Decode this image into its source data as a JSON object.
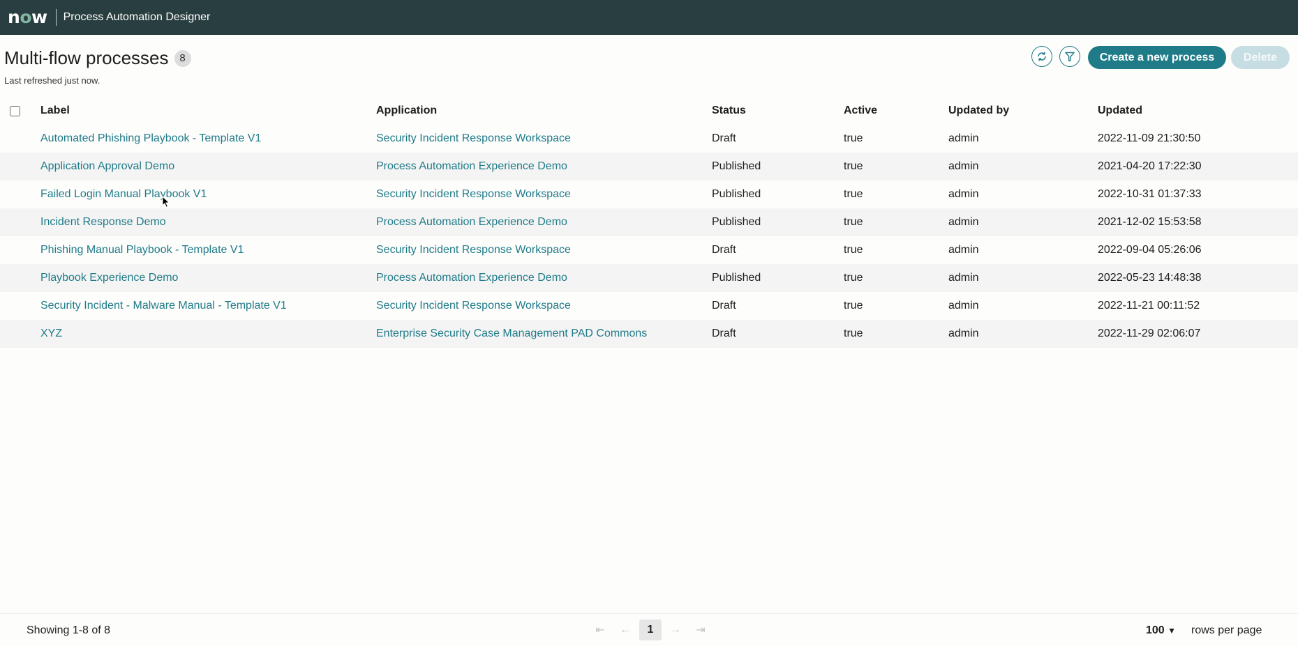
{
  "header": {
    "logo": "now",
    "app_title": "Process Automation Designer"
  },
  "page": {
    "title": "Multi-flow processes",
    "count": "8",
    "refreshed": "Last refreshed just now.",
    "refresh_icon": "refresh-icon",
    "filter_icon": "filter-icon",
    "create_label": "Create a new process",
    "delete_label": "Delete"
  },
  "table": {
    "columns": [
      "Label",
      "Application",
      "Status",
      "Active",
      "Updated by",
      "Updated"
    ],
    "rows": [
      {
        "label": "Automated Phishing Playbook - Template V1",
        "application": "Security Incident Response Workspace",
        "status": "Draft",
        "active": "true",
        "updated_by": "admin",
        "updated": "2022-11-09 21:30:50"
      },
      {
        "label": "Application Approval Demo",
        "application": "Process Automation Experience Demo",
        "status": "Published",
        "active": "true",
        "updated_by": "admin",
        "updated": "2021-04-20 17:22:30"
      },
      {
        "label": "Failed Login Manual Playbook V1",
        "application": "Security Incident Response Workspace",
        "status": "Published",
        "active": "true",
        "updated_by": "admin",
        "updated": "2022-10-31 01:37:33"
      },
      {
        "label": "Incident Response Demo",
        "application": "Process Automation Experience Demo",
        "status": "Published",
        "active": "true",
        "updated_by": "admin",
        "updated": "2021-12-02 15:53:58"
      },
      {
        "label": "Phishing Manual Playbook - Template V1",
        "application": "Security Incident Response Workspace",
        "status": "Draft",
        "active": "true",
        "updated_by": "admin",
        "updated": "2022-09-04 05:26:06"
      },
      {
        "label": "Playbook Experience Demo",
        "application": "Process Automation Experience Demo",
        "status": "Published",
        "active": "true",
        "updated_by": "admin",
        "updated": "2022-05-23 14:48:38"
      },
      {
        "label": "Security Incident - Malware Manual - Template V1",
        "application": "Security Incident Response Workspace",
        "status": "Draft",
        "active": "true",
        "updated_by": "admin",
        "updated": "2022-11-21 00:11:52"
      },
      {
        "label": "XYZ",
        "application": "Enterprise Security Case Management PAD Commons",
        "status": "Draft",
        "active": "true",
        "updated_by": "admin",
        "updated": "2022-11-29 02:06:07"
      }
    ]
  },
  "footer": {
    "showing": "Showing 1-8 of 8",
    "current_page": "1",
    "rows_per_page_value": "100",
    "rows_per_page_label": "rows per page"
  },
  "colors": {
    "topbar": "#293e40",
    "accent": "#1f7b88",
    "logo_accent": "#81b5a1"
  }
}
